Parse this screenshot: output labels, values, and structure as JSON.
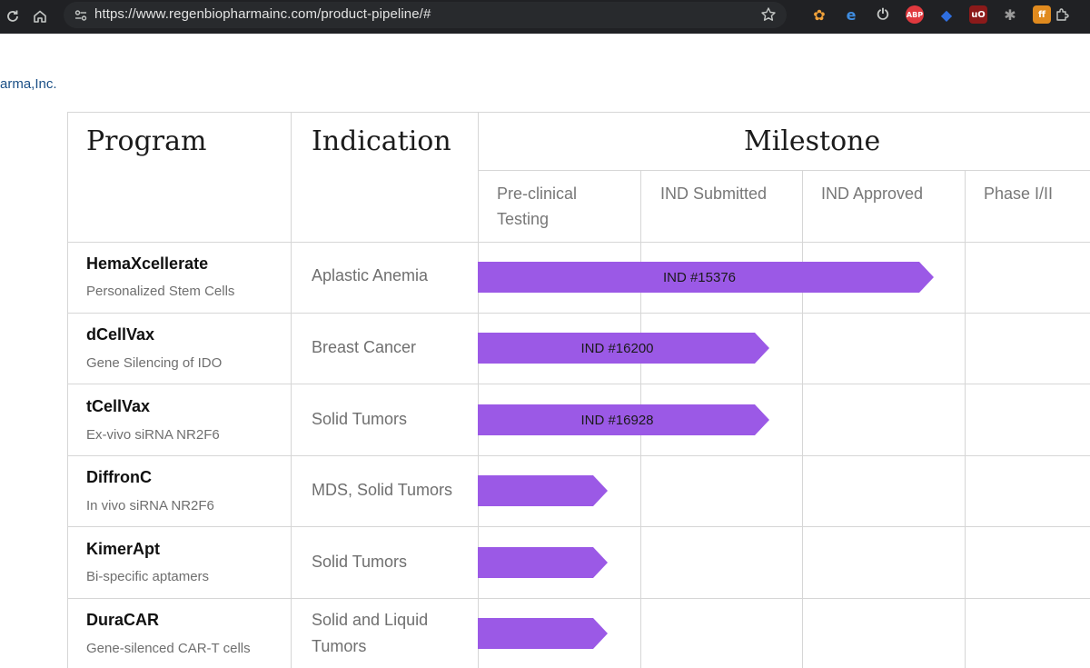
{
  "browser": {
    "url": "https://www.regenbiopharmainc.com/product-pipeline/#",
    "icons": [
      "reload-icon",
      "home-icon",
      "site-settings-icon",
      "bookmark-star-icon",
      "puzzle-extensions-icon"
    ],
    "extensions": [
      {
        "name": "ext-butterfly-icon",
        "glyph": "✿",
        "color": "#f2a23a"
      },
      {
        "name": "ext-e-icon",
        "glyph": "e",
        "color": "#3f8de0"
      },
      {
        "name": "ext-power-icon",
        "glyph": "⏻",
        "color": "#c4c7c5"
      },
      {
        "name": "ext-abp-icon",
        "glyph": "ABP",
        "color": "#e0393e"
      },
      {
        "name": "ext-shield-icon",
        "glyph": "◆",
        "color": "#2f6fe0"
      },
      {
        "name": "ext-ublock-icon",
        "glyph": "uO",
        "color": "#8b1a1a"
      },
      {
        "name": "ext-spider-icon",
        "glyph": "✱",
        "color": "#9a9a9a"
      },
      {
        "name": "ext-rss-icon",
        "glyph": "ff",
        "color": "#e08a1e"
      }
    ]
  },
  "page": {
    "brand_fragment": "arma,Inc.",
    "accent_color": "#9b59e6",
    "headers": {
      "program": "Program",
      "indication": "Indication",
      "milestone": "Milestone",
      "stages": [
        "Pre-clinical Testing",
        "IND Submitted",
        "IND Approved",
        "Phase I/II"
      ]
    },
    "rows": [
      {
        "name": "HemaXcellerate",
        "desc": "Personalized Stem Cells",
        "indication": "Aplastic Anemia",
        "progress_stages": 2.81,
        "label": "IND #15376"
      },
      {
        "name": "dCellVax",
        "desc": "Gene Silencing of IDO",
        "indication": "Breast Cancer",
        "progress_stages": 1.8,
        "label": "IND #16200"
      },
      {
        "name": "tCellVax",
        "desc": "Ex-vivo siRNA NR2F6",
        "indication": "Solid Tumors",
        "progress_stages": 1.8,
        "label": "IND #16928"
      },
      {
        "name": "DiffronC",
        "desc": "In vivo siRNA NR2F6",
        "indication": "MDS, Solid Tumors",
        "progress_stages": 0.8,
        "label": ""
      },
      {
        "name": "KimerApt",
        "desc": "Bi-specific aptamers",
        "indication": "Solid Tumors",
        "progress_stages": 0.8,
        "label": ""
      },
      {
        "name": "DuraCAR",
        "desc": "Gene-silenced CAR-T cells",
        "indication": "Solid and Liquid Tumors",
        "progress_stages": 0.8,
        "label": ""
      }
    ]
  }
}
